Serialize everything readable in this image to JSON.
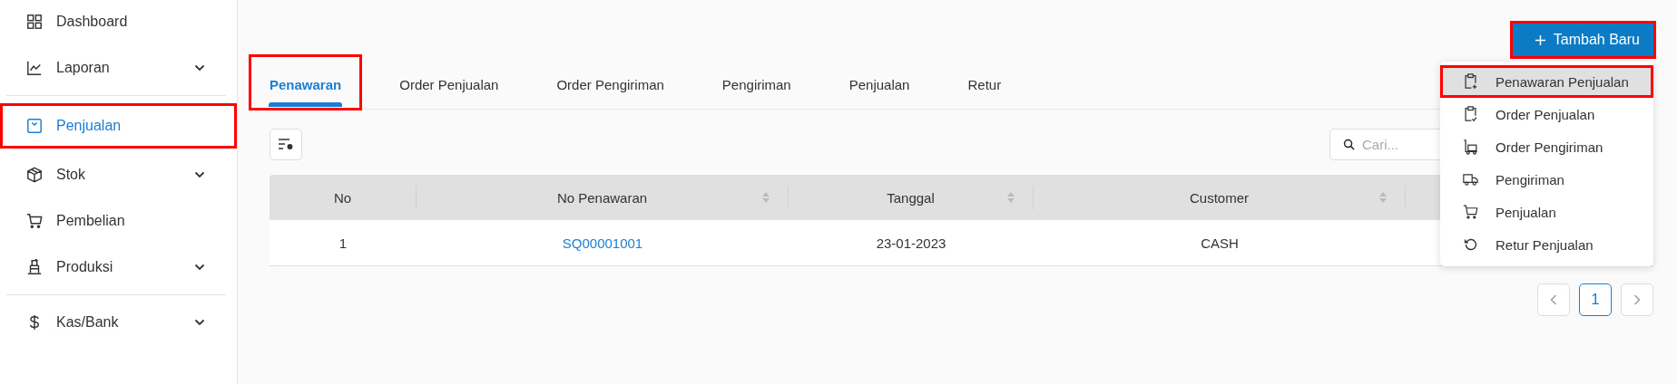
{
  "sidebar": {
    "groups": [
      [
        {
          "label": "Dashboard",
          "selected": false,
          "expandable": false,
          "highlighted": false
        },
        {
          "label": "Laporan",
          "selected": false,
          "expandable": true,
          "highlighted": false
        }
      ],
      [
        {
          "label": "Penjualan",
          "selected": true,
          "expandable": false,
          "highlighted": true
        },
        {
          "label": "Stok",
          "selected": false,
          "expandable": true,
          "highlighted": false
        },
        {
          "label": "Pembelian",
          "selected": false,
          "expandable": false,
          "highlighted": false
        },
        {
          "label": "Produksi",
          "selected": false,
          "expandable": true,
          "highlighted": false
        }
      ],
      [
        {
          "label": "Kas/Bank",
          "selected": false,
          "expandable": true,
          "highlighted": false
        }
      ]
    ]
  },
  "add_button": {
    "label": "Tambah Baru",
    "highlighted": true
  },
  "add_menu": {
    "items": [
      {
        "label": "Penawaran Penjualan",
        "selected": true,
        "highlighted": true
      },
      {
        "label": "Order Penjualan",
        "selected": false,
        "highlighted": false
      },
      {
        "label": "Order Pengiriman",
        "selected": false,
        "highlighted": false
      },
      {
        "label": "Pengiriman",
        "selected": false,
        "highlighted": false
      },
      {
        "label": "Penjualan",
        "selected": false,
        "highlighted": false
      },
      {
        "label": "Retur Penjualan",
        "selected": false,
        "highlighted": false
      }
    ]
  },
  "tabs": [
    {
      "label": "Penawaran",
      "selected": true,
      "highlighted": true
    },
    {
      "label": "Order Penjualan",
      "selected": false,
      "highlighted": false
    },
    {
      "label": "Order Pengiriman",
      "selected": false,
      "highlighted": false
    },
    {
      "label": "Pengiriman",
      "selected": false,
      "highlighted": false
    },
    {
      "label": "Penjualan",
      "selected": false,
      "highlighted": false
    },
    {
      "label": "Retur",
      "selected": false,
      "highlighted": false
    }
  ],
  "search": {
    "placeholder": "Cari..."
  },
  "table": {
    "columns": [
      {
        "label": "No",
        "sortable": false,
        "kind": "text"
      },
      {
        "label": "No Penawaran",
        "sortable": true,
        "kind": "link"
      },
      {
        "label": "Tanggal",
        "sortable": true,
        "kind": "text"
      },
      {
        "label": "Customer",
        "sortable": true,
        "kind": "text"
      }
    ],
    "rows": [
      {
        "cells": [
          "1",
          "SQ00001001",
          "23-01-2023",
          "CASH"
        ]
      }
    ]
  },
  "pagination": {
    "pages": [
      {
        "label": "1",
        "selected": true
      }
    ]
  }
}
